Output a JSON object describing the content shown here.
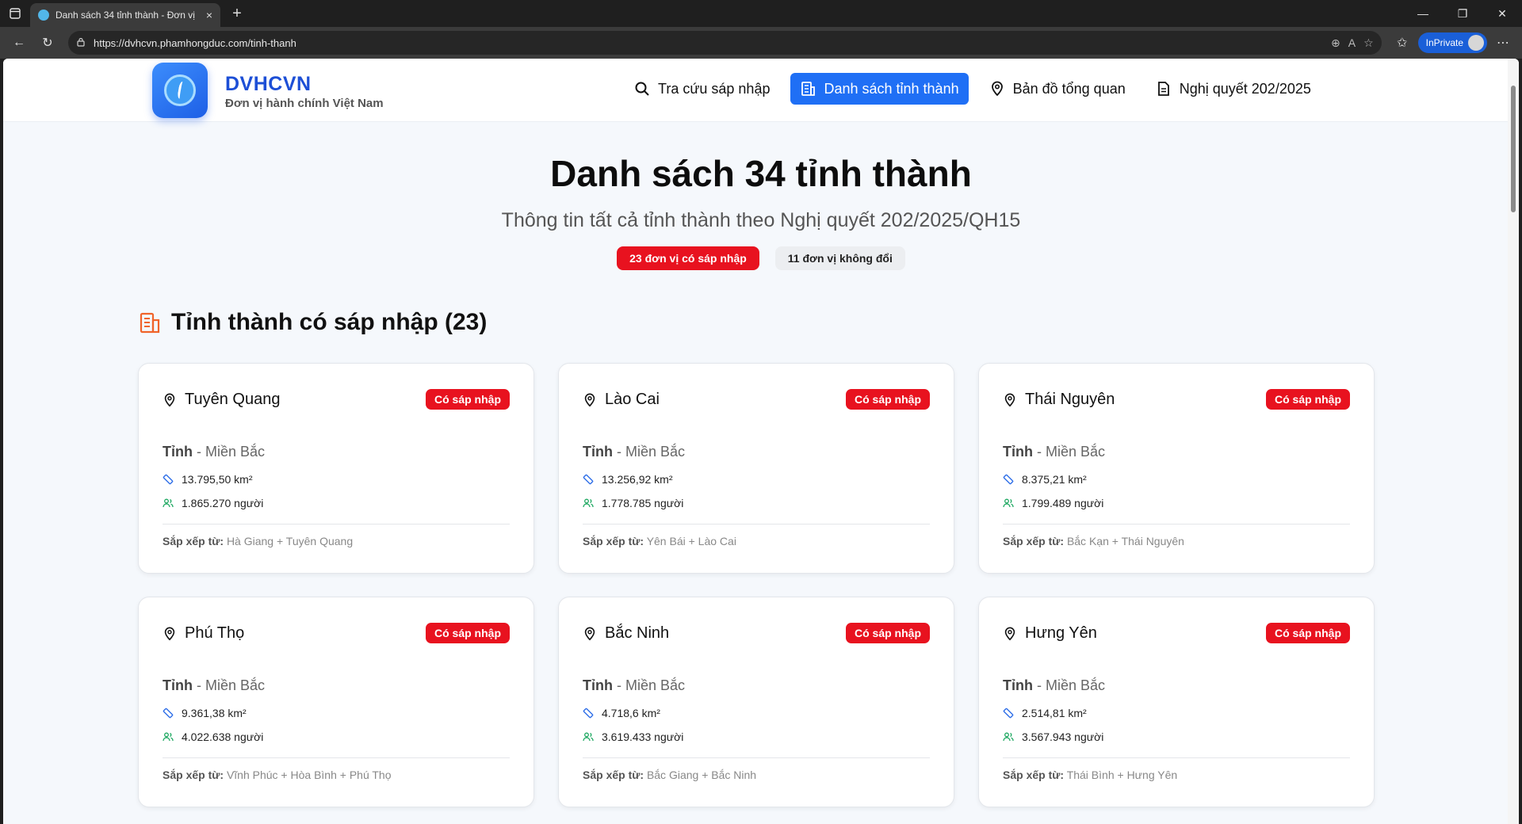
{
  "browser": {
    "tab_title": "Danh sách 34 tỉnh thành - Đơn vị",
    "tab_close": "×",
    "new_tab": "+",
    "url": "https://dvhcvn.phamhongduc.com/tinh-thanh",
    "inprivate_label": "InPrivate"
  },
  "header": {
    "brand_name": "DVHCVN",
    "brand_subtitle": "Đơn vị hành chính Việt Nam",
    "nav": [
      {
        "label": "Tra cứu sáp nhập",
        "icon": "search-icon",
        "active": false
      },
      {
        "label": "Danh sách tỉnh thành",
        "icon": "building-icon",
        "active": true
      },
      {
        "label": "Bản đồ tổng quan",
        "icon": "map-pin-icon",
        "active": false
      },
      {
        "label": "Nghị quyết 202/2025",
        "icon": "document-icon",
        "active": false
      }
    ]
  },
  "hero": {
    "title": "Danh sách 34 tỉnh thành",
    "description": "Thông tin tất cả tỉnh thành theo Nghị quyết 202/2025/QH15",
    "pill_merged": "23 đơn vị có sáp nhập",
    "pill_unchanged": "11 đơn vị không đổi"
  },
  "section": {
    "title": "Tỉnh thành có sáp nhập (23)"
  },
  "labels": {
    "badge": "Có sáp nhập",
    "from_prefix": "Sắp xếp từ:"
  },
  "colors": {
    "accent_blue": "#1f6ff5",
    "badge_red": "#e8121f",
    "section_icon_orange": "#f0642a"
  },
  "provinces": [
    {
      "name": "Tuyên Quang",
      "type": "Tỉnh",
      "region": " - Miền Bắc",
      "area": "13.795,50 km²",
      "population": "1.865.270 người",
      "from": "Hà Giang + Tuyên Quang"
    },
    {
      "name": "Lào Cai",
      "type": "Tỉnh",
      "region": " - Miền Bắc",
      "area": "13.256,92 km²",
      "population": "1.778.785 người",
      "from": "Yên Bái + Lào Cai"
    },
    {
      "name": "Thái Nguyên",
      "type": "Tỉnh",
      "region": " - Miền Bắc",
      "area": "8.375,21 km²",
      "population": "1.799.489 người",
      "from": "Bắc Kạn + Thái Nguyên"
    },
    {
      "name": "Phú Thọ",
      "type": "Tỉnh",
      "region": " - Miền Bắc",
      "area": "9.361,38 km²",
      "population": "4.022.638 người",
      "from": "Vĩnh Phúc + Hòa Bình + Phú Thọ"
    },
    {
      "name": "Bắc Ninh",
      "type": "Tỉnh",
      "region": " - Miền Bắc",
      "area": "4.718,6 km²",
      "population": "3.619.433 người",
      "from": "Bắc Giang + Bắc Ninh"
    },
    {
      "name": "Hưng Yên",
      "type": "Tỉnh",
      "region": " - Miền Bắc",
      "area": "2.514,81 km²",
      "population": "3.567.943 người",
      "from": "Thái Bình + Hưng Yên"
    }
  ]
}
